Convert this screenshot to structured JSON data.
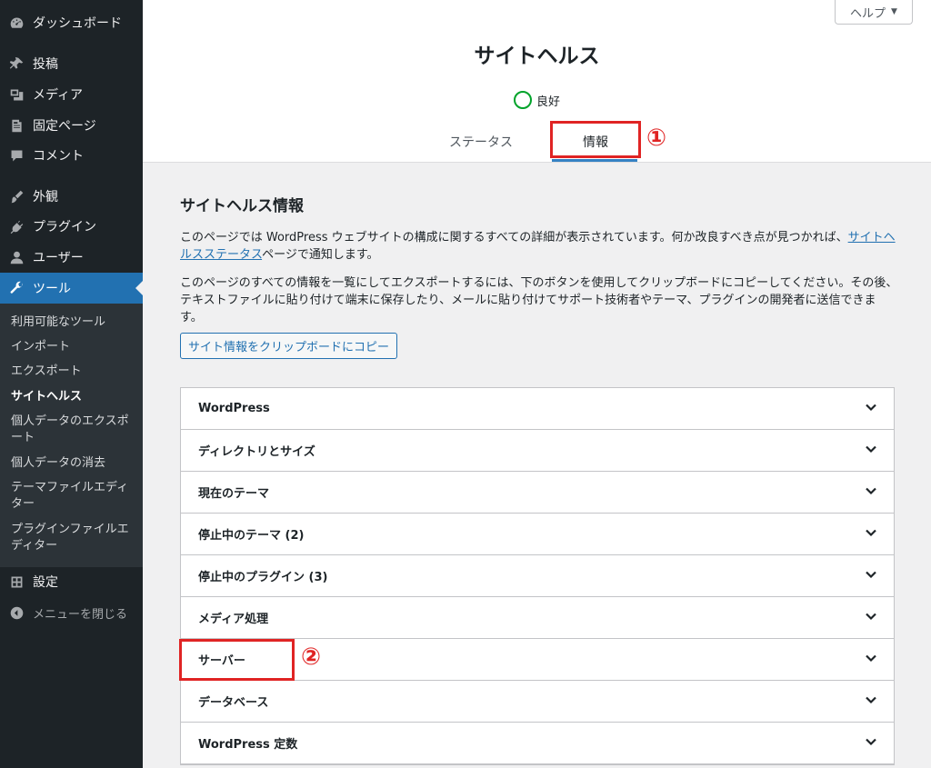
{
  "sidebar": {
    "items": [
      {
        "label": "ダッシュボード",
        "icon": "dashboard-icon"
      },
      {
        "label": "投稿",
        "icon": "pin-icon"
      },
      {
        "label": "メディア",
        "icon": "media-icon"
      },
      {
        "label": "固定ページ",
        "icon": "page-icon"
      },
      {
        "label": "コメント",
        "icon": "comment-icon"
      },
      {
        "label": "外観",
        "icon": "brush-icon"
      },
      {
        "label": "プラグイン",
        "icon": "plugin-icon"
      },
      {
        "label": "ユーザー",
        "icon": "user-icon"
      },
      {
        "label": "ツール",
        "icon": "wrench-icon"
      },
      {
        "label": "設定",
        "icon": "settings-icon"
      }
    ],
    "submenu": [
      "利用可能なツール",
      "インポート",
      "エクスポート",
      "サイトヘルス",
      "個人データのエクスポート",
      "個人データの消去",
      "テーマファイルエディター",
      "プラグインファイルエディター"
    ],
    "collapse_label": "メニューを閉じる"
  },
  "header": {
    "help_label": "ヘルプ",
    "title": "サイトヘルス",
    "status_label": "良好",
    "tabs": {
      "status": "ステータス",
      "info": "情報"
    }
  },
  "annotations": {
    "one": "①",
    "two": "②"
  },
  "main": {
    "section_title": "サイトヘルス情報",
    "para1_text": "このページでは WordPress ウェブサイトの構成に関するすべての詳細が表示されています。何か改良すべき点が見つかれば、",
    "para1_link": "サイトヘルスステータス",
    "para1_tail": "ページで通知します。",
    "para2": "このページのすべての情報を一覧にしてエクスポートするには、下のボタンを使用してクリップボードにコピーしてください。その後、テキストファイルに貼り付けて端末に保存したり、メールに貼り付けてサポート技術者やテーマ、プラグインの開発者に送信できます。",
    "copy_button": "サイト情報をクリップボードにコピー",
    "sections": [
      "WordPress",
      "ディレクトリとサイズ",
      "現在のテーマ",
      "停止中のテーマ (2)",
      "停止中のプラグイン (3)",
      "メディア処理",
      "サーバー",
      "データベース",
      "WordPress 定数"
    ]
  },
  "colors": {
    "accent": "#2271b1",
    "annotation": "#e02424",
    "sidebar": "#1d2327",
    "good": "#00a32a"
  }
}
